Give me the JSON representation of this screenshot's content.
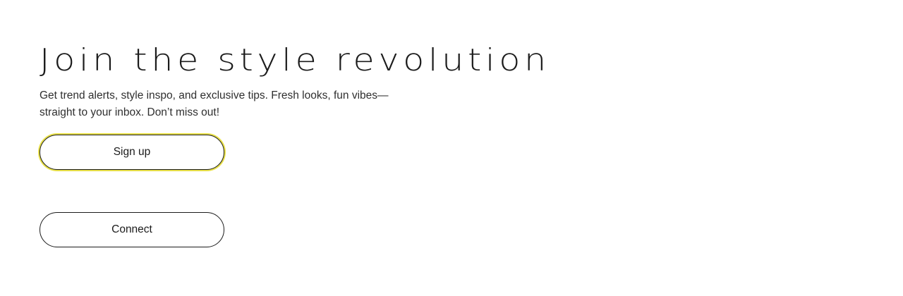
{
  "hero": {
    "title": "Join the style revolution",
    "subtitle": "Get trend alerts, style inspo, and exclusive tips. Fresh looks, fun vibes—straight to your inbox. Don’t miss out!",
    "signup_label": "Sign up",
    "connect_label": "Connect"
  },
  "colors": {
    "text": "#1b1b1b",
    "focus_ring": "#e8e04a",
    "background": "#ffffff"
  }
}
